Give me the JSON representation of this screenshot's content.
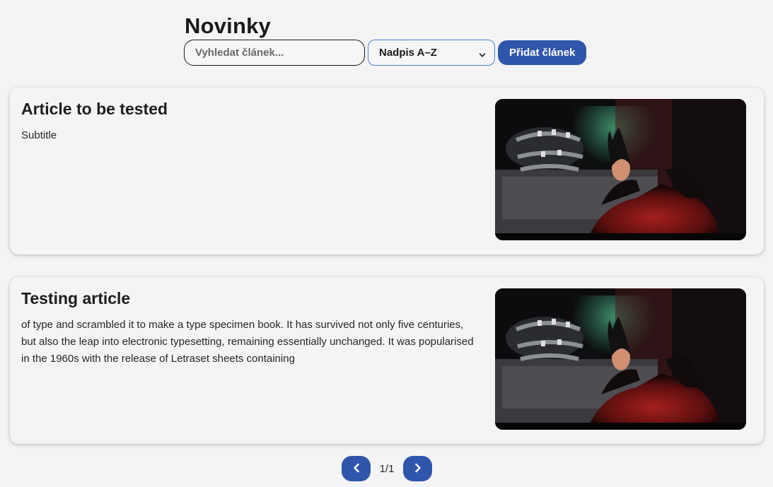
{
  "header": {
    "title": "Novinky"
  },
  "toolbar": {
    "search_placeholder": "Vyhledat článek...",
    "sort_selected": "Nadpis A–Z",
    "add_label": "Přidat článek"
  },
  "articles": [
    {
      "title": "Article to be tested",
      "text": "Subtitle"
    },
    {
      "title": "Testing article",
      "text": "of type and scrambled it to make a type specimen book. It has survived not only five centuries, but also the leap into electronic typesetting, remaining essentially unchanged. It was popularised in the 1960s with the release of Letraset sheets containing"
    }
  ],
  "pagination": {
    "indicator": "1/1",
    "prev_icon": "chevron-left-icon",
    "next_icon": "chevron-right-icon"
  },
  "colors": {
    "accent": "#2f56aa",
    "background": "#f4f4f4",
    "select_border": "#4a7fd8"
  }
}
